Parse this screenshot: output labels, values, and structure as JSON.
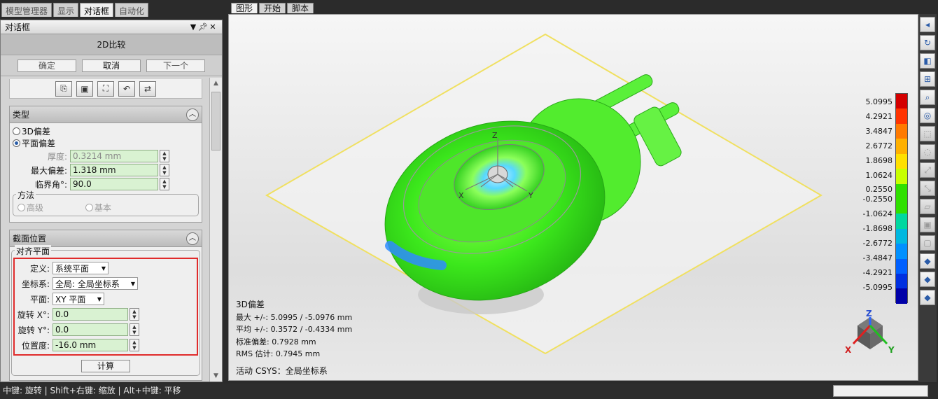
{
  "left_tabs": [
    "模型管理器",
    "显示",
    "对话框",
    "自动化"
  ],
  "panel": {
    "title": "对话框",
    "pin_icon": "pin-icon",
    "subtitle": "2D比较",
    "buttons": {
      "ok": "确定",
      "cancel": "取消",
      "next": "下一个"
    }
  },
  "type_group": {
    "title": "类型",
    "option_3d": "3D偏差",
    "option_plane": "平面偏差",
    "thickness_label": "厚度:",
    "thickness_value": "0.3214 mm",
    "max_dev_label": "最大偏差:",
    "max_dev_value": "1.318 mm",
    "critical_angle_label": "临界角°:",
    "critical_angle_value": "90.0",
    "method_legend": "方法",
    "method_advanced": "高级",
    "method_basic": "基本"
  },
  "section_group": {
    "title": "截面位置",
    "align_legend": "对齐平面",
    "define_label": "定义:",
    "define_value": "系统平面",
    "coord_label": "坐标系:",
    "coord_value": "全局: 全局坐标系",
    "plane_label": "平面:",
    "plane_value": "XY 平面",
    "rot_x_label": "旋转 X°:",
    "rot_x_value": "0.0",
    "rot_y_label": "旋转 Y°:",
    "rot_y_value": "0.0",
    "position_label": "位置度:",
    "position_value": "-16.0 mm",
    "calc_button": "计算"
  },
  "view_tabs": [
    "图形",
    "开始",
    "脚本"
  ],
  "viewport": {
    "stats": {
      "title": "3D偏差",
      "max": "最大 +/-: 5.0995 / -5.0976 mm",
      "avg": "平均 +/-: 0.3572 / -0.4334 mm",
      "std": "标准偏差: 0.7928 mm",
      "rms": "RMS 估计:   0.7945 mm"
    },
    "csys": "活动 CSYS：全局坐标系",
    "axis_labels": {
      "x": "X",
      "y": "Y",
      "z": "Z"
    }
  },
  "legend": {
    "labels": [
      "5.0995",
      "4.2921",
      "3.4847",
      "2.6772",
      "1.8698",
      "1.0624",
      "0.2550",
      "-0.2550",
      "-1.0624",
      "-1.8698",
      "-2.6772",
      "-3.4847",
      "-4.2921",
      "-5.0995"
    ],
    "colors": [
      "#d40000",
      "#ff3300",
      "#ff7a00",
      "#ffb000",
      "#ffe000",
      "#c8ff00",
      "#30e000",
      "#30e000",
      "#00d8a0",
      "#00b8e0",
      "#0090ff",
      "#0060ff",
      "#0030e0",
      "#0000a8"
    ]
  },
  "right_toolbar_icons": [
    "pointer-icon",
    "rotate-icon",
    "view-icon",
    "mesh-icon",
    "zoom-icon",
    "color-icon",
    "select-rect-icon",
    "select-lasso-icon",
    "select-brush-icon",
    "select-line-icon",
    "select-polygon-icon",
    "select-all-icon",
    "select-icon",
    "cube-icon",
    "cube-icon",
    "cube-icon"
  ],
  "statusbar": "中键: 旋转 | Shift+右键: 缩放 | Alt+中键: 平移"
}
